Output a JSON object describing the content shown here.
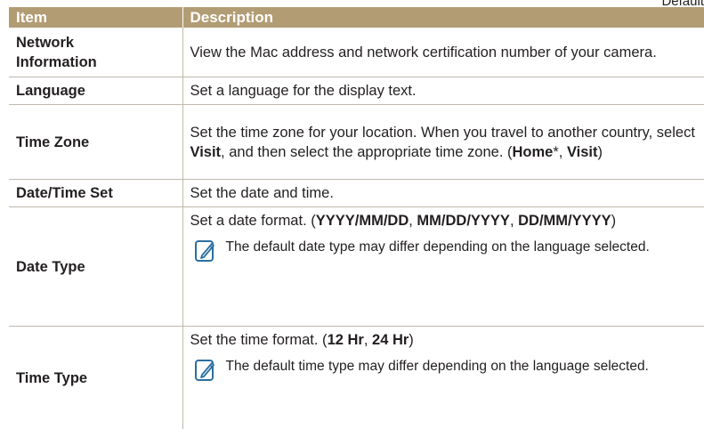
{
  "corner_label": "Default",
  "table": {
    "headers": {
      "item": "Item",
      "description": "Description"
    },
    "rows": {
      "network": {
        "item_line1": "Network",
        "item_line2": "Information",
        "desc": "View the Mac address and network certification number of your camera."
      },
      "language": {
        "item": "Language",
        "desc": "Set a language for the display text."
      },
      "timezone": {
        "item": "Time Zone",
        "desc_prefix": "Set the time zone for your location. When you travel to another country, select ",
        "visit": "Visit",
        "desc_mid": ", and then select the appropriate time zone. (",
        "home": "Home",
        "asterisk": "*, ",
        "visit2": "Visit",
        "close": ")"
      },
      "datetime": {
        "item": "Date/Time Set",
        "desc": "Set the date and time."
      },
      "datetype": {
        "item": "Date Type",
        "desc_prefix": "Set a date format. (",
        "fmt1": "YYYY/MM/DD",
        "sep1": ", ",
        "fmt2": "MM/DD/YYYY",
        "sep2": ", ",
        "fmt3": "DD/MM/YYYY",
        "close": ")",
        "note": "The default date type may differ depending on the language selected.",
        "note_icon": "note-pencil-icon"
      },
      "timetype": {
        "item": "Time Type",
        "desc_prefix": "Set the time format. (",
        "fmt1": "12 Hr",
        "sep1": ", ",
        "fmt2": "24 Hr",
        "close": ")",
        "note": "The default time type may differ depending on the language selected.",
        "note_icon": "note-pencil-icon"
      }
    }
  },
  "colors": {
    "header_bg": "#b29c74",
    "border": "#bfb9ad",
    "text": "#231f20",
    "icon": "#2b6f9e"
  }
}
